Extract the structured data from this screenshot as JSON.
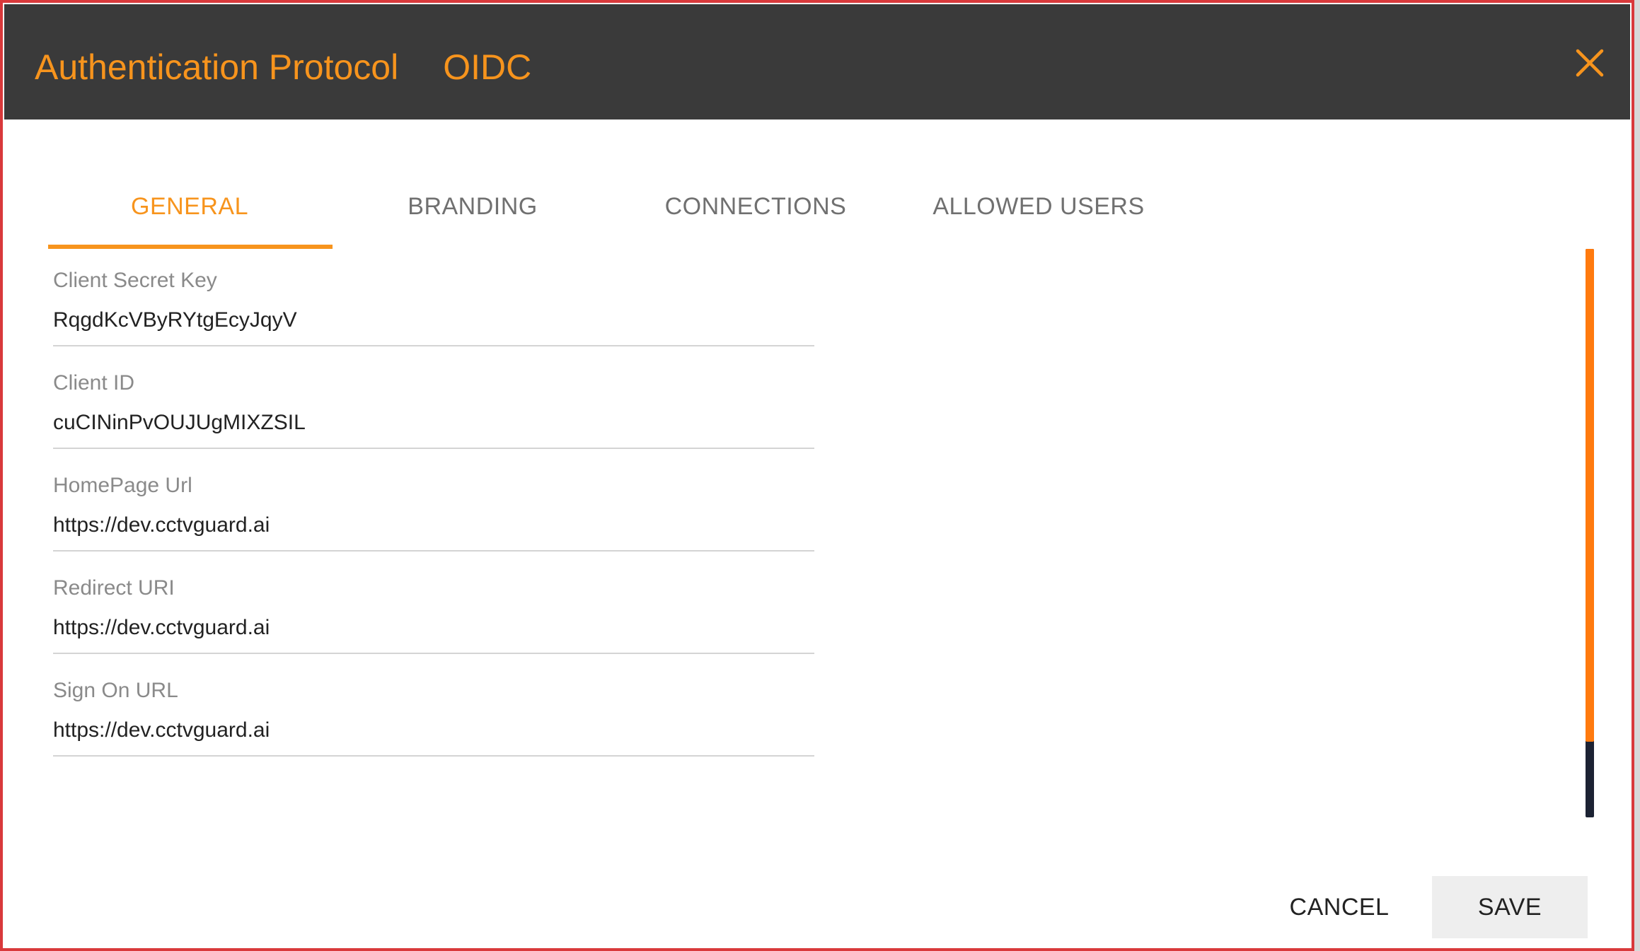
{
  "header": {
    "title": "Authentication Protocol",
    "protocol": "OIDC",
    "close_icon": "close-icon"
  },
  "tabs": [
    {
      "label": "GENERAL",
      "active": true
    },
    {
      "label": "BRANDING",
      "active": false
    },
    {
      "label": "CONNECTIONS",
      "active": false
    },
    {
      "label": "ALLOWED USERS",
      "active": false
    }
  ],
  "fields": [
    {
      "label": "Client Secret Key",
      "value": "RqgdKcVByRYtgEcyJqyV"
    },
    {
      "label": "Client ID",
      "value": "cuCINinPvOUJUgMIXZSIL"
    },
    {
      "label": "HomePage Url",
      "value": "https://dev.cctvguard.ai"
    },
    {
      "label": "Redirect URI",
      "value": "https://dev.cctvguard.ai"
    },
    {
      "label": "Sign On URL",
      "value": "https://dev.cctvguard.ai"
    }
  ],
  "footer": {
    "cancel_label": "CANCEL",
    "save_label": "SAVE"
  },
  "colors": {
    "accent": "#f7941d",
    "header_bg": "#3a3a3a",
    "scroll_thumb": "#ff7a0e",
    "scroll_track": "#1c2233",
    "border": "#d9393b"
  }
}
